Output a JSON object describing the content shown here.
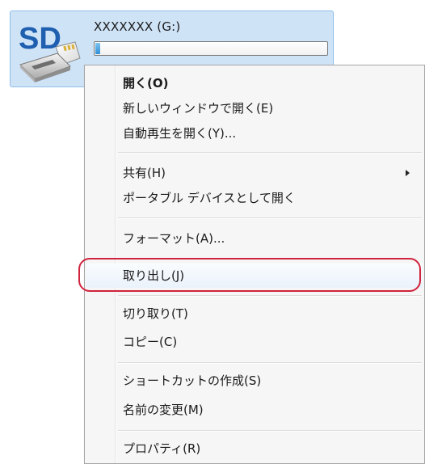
{
  "drive": {
    "name": "XXXXXXX (G:)",
    "icon": "sd-card-reader-icon",
    "icon_text": "SD",
    "capacity_used_fraction": 0.02
  },
  "menu": {
    "items": [
      {
        "label": "開く(O)",
        "bold": true
      },
      {
        "label": "新しいウィンドウで開く(E)"
      },
      {
        "label": "自動再生を開く(Y)..."
      },
      {
        "label": "共有(H)",
        "submenu": true
      },
      {
        "label": "ポータブル デバイスとして開く"
      },
      {
        "label": "フォーマット(A)..."
      },
      {
        "label": "取り出し(J)",
        "highlighted": true
      },
      {
        "label": "切り取り(T)"
      },
      {
        "label": "コピー(C)"
      },
      {
        "label": "ショートカットの作成(S)"
      },
      {
        "label": "名前の変更(M)"
      },
      {
        "label": "プロパティ(R)"
      }
    ]
  },
  "colors": {
    "selection_bg": "#cfe3f7",
    "annotation": "#d0233c",
    "icon_text": "#1f5fb0"
  }
}
